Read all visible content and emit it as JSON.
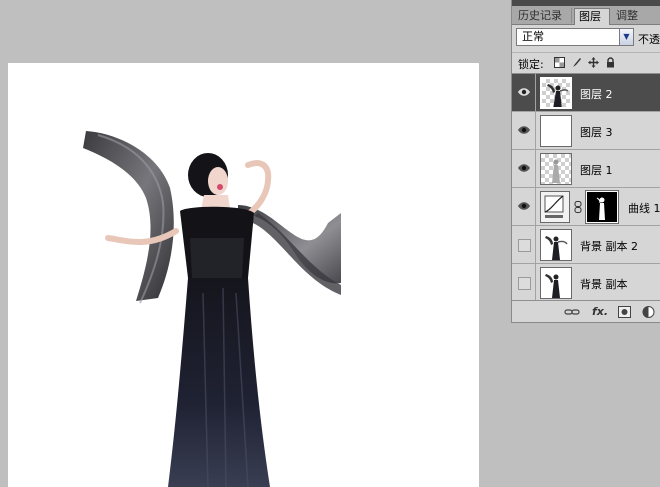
{
  "panel": {
    "tabs": [
      {
        "label": "历史记录",
        "active": false
      },
      {
        "label": "图层",
        "active": true
      },
      {
        "label": "调整",
        "active": false
      }
    ],
    "blend_mode": "正常",
    "opacity_label": "不透",
    "lock_label": "锁定:",
    "layers": [
      {
        "name": "图层 2",
        "visible": true,
        "selected": true
      },
      {
        "name": "图层 3",
        "visible": true,
        "selected": false
      },
      {
        "name": "图层 1",
        "visible": true,
        "selected": false
      },
      {
        "name": "曲线 1",
        "visible": true,
        "selected": false,
        "type": "curves-adjustment"
      },
      {
        "name": "背景 副本 2",
        "visible": false,
        "selected": false
      },
      {
        "name": "背景 副本",
        "visible": false,
        "selected": false
      }
    ],
    "footer_icons": [
      "link-icon",
      "fx-icon",
      "mask-icon",
      "adjustment-icon"
    ]
  },
  "colors": {
    "workspace": "#bfbfbf",
    "panel": "#d6d6d6",
    "selected_row": "#4c4c4c",
    "tab_bar": "#a8a8a8"
  }
}
